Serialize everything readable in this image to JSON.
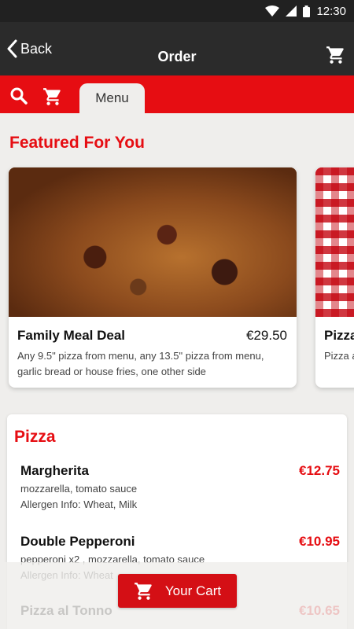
{
  "status_bar": {
    "time": "12:30",
    "icons": [
      "wifi-icon",
      "cell-signal-icon",
      "battery-icon"
    ]
  },
  "app_bar": {
    "back_label": "Back",
    "title": "Order",
    "icons": [
      "chevron-left-icon",
      "cart-icon"
    ]
  },
  "tool_bar": {
    "tab_label": "Menu",
    "icons": [
      "search-icon",
      "cart-icon"
    ]
  },
  "featured": {
    "title": "Featured For You",
    "cards": [
      {
        "name": "Family Meal Deal",
        "price": "€29.50",
        "description": "Any 9.5\" pizza from menu, any 13.5\" pizza from menu, garlic bread or house fries, one other side"
      },
      {
        "name": "Pizza",
        "price": "",
        "description": "Pizza a"
      }
    ]
  },
  "menu": {
    "section_title": "Pizza",
    "items": [
      {
        "name": "Margherita",
        "price": "€12.75",
        "line1": "mozzarella, tomato sauce",
        "line2": "Allergen Info: Wheat, Milk"
      },
      {
        "name": "Double Pepperoni",
        "price": "€10.95",
        "line1": "pepperoni x2 , mozzarella, tomato sauce",
        "line2": "Allergen Info: Wheat"
      },
      {
        "name": "Pizza al Tonno",
        "price": "€10.65",
        "line1": "",
        "line2": ""
      }
    ]
  },
  "cart_button": {
    "label": "Your Cart",
    "icon": "cart-icon"
  },
  "colors": {
    "brand_red": "#e60d12",
    "app_bar": "#2b2b2b",
    "status_bar": "#212121",
    "background": "#efeeec"
  }
}
